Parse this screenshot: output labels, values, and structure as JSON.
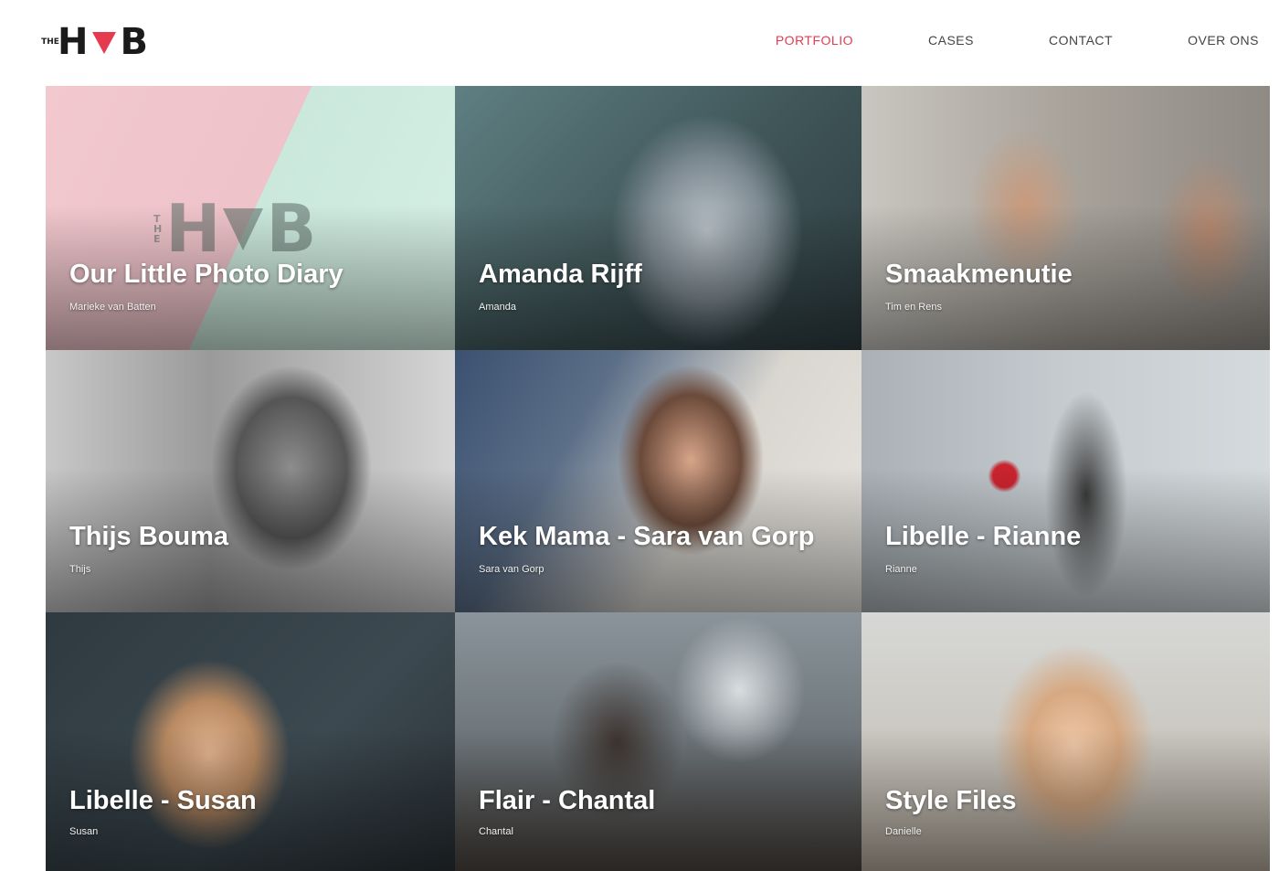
{
  "brand": {
    "the": "THE",
    "h": "H",
    "b": "B",
    "accent": "#e63a4e"
  },
  "nav": [
    {
      "label": "PORTFOLIO",
      "active": true
    },
    {
      "label": "CASES",
      "active": false
    },
    {
      "label": "CONTACT",
      "active": false
    },
    {
      "label": "OVER ONS",
      "active": false
    }
  ],
  "tiles": [
    {
      "title": "Our Little Photo Diary",
      "subtitle": "Marieke van Batten",
      "icon": "hvb-logo-watermark"
    },
    {
      "title": "Amanda Rijff",
      "subtitle": "Amanda",
      "icon": "portrait-photo"
    },
    {
      "title": "Smaakmenutie",
      "subtitle": "Tim en Rens",
      "icon": "portrait-photo"
    },
    {
      "title": "Thijs Bouma",
      "subtitle": "Thijs",
      "icon": "portrait-photo"
    },
    {
      "title": "Kek Mama - Sara van Gorp",
      "subtitle": "Sara van Gorp",
      "icon": "portrait-photo"
    },
    {
      "title": "Libelle - Rianne",
      "subtitle": "Rianne",
      "icon": "portrait-photo"
    },
    {
      "title": "Libelle - Susan",
      "subtitle": "Susan",
      "icon": "portrait-photo"
    },
    {
      "title": "Flair - Chantal",
      "subtitle": "Chantal",
      "icon": "portrait-photo"
    },
    {
      "title": "Style Files",
      "subtitle": "Danielle",
      "icon": "portrait-photo"
    }
  ]
}
